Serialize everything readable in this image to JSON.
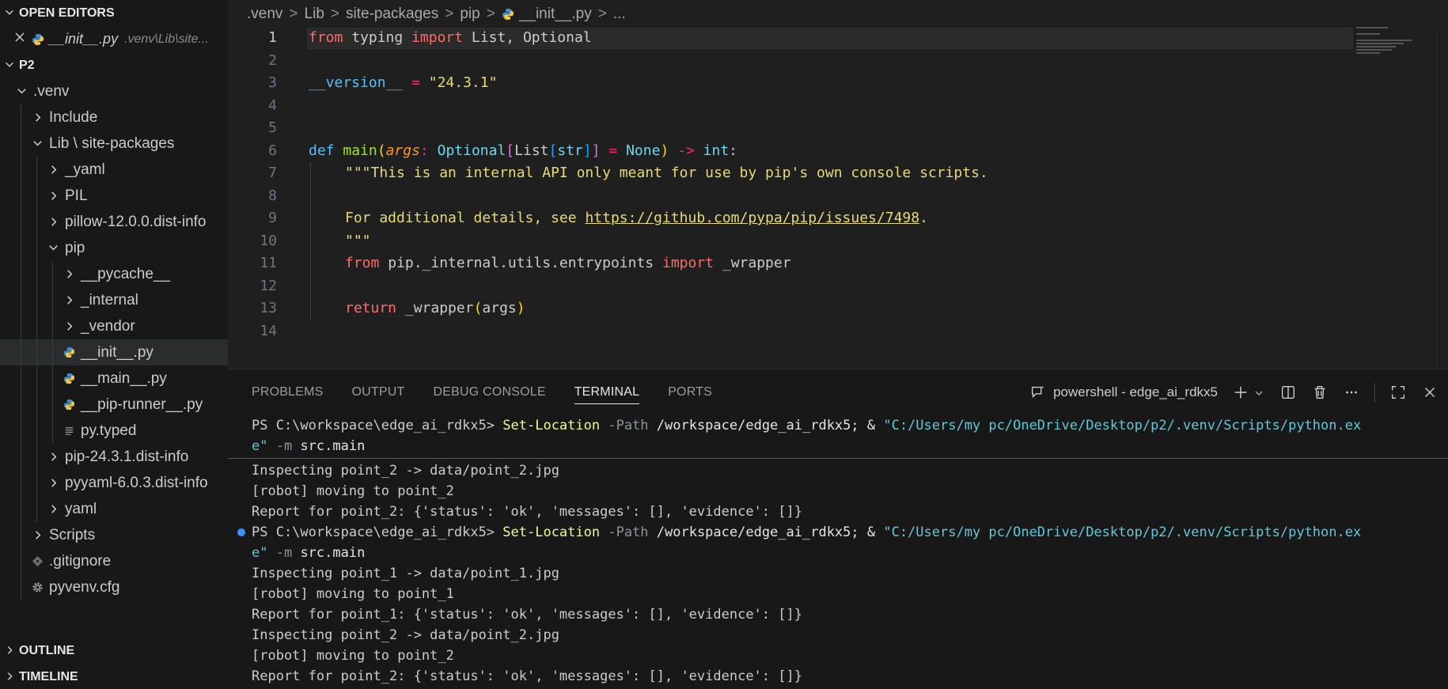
{
  "sidebar": {
    "open_editors_title": "OPEN EDITORS",
    "open_editor": {
      "name": "__init__.py",
      "path": ".venv\\Lib\\site..."
    },
    "project_title": "P2",
    "tree": [
      {
        "label": ".venv",
        "depth": 0,
        "kind": "folder-open"
      },
      {
        "label": "Include",
        "depth": 1,
        "kind": "folder"
      },
      {
        "label": "Lib \\ site-packages",
        "depth": 1,
        "kind": "folder-open"
      },
      {
        "label": "_yaml",
        "depth": 2,
        "kind": "folder"
      },
      {
        "label": "PIL",
        "depth": 2,
        "kind": "folder"
      },
      {
        "label": "pillow-12.0.0.dist-info",
        "depth": 2,
        "kind": "folder"
      },
      {
        "label": "pip",
        "depth": 2,
        "kind": "folder-open"
      },
      {
        "label": "__pycache__",
        "depth": 3,
        "kind": "folder"
      },
      {
        "label": "_internal",
        "depth": 3,
        "kind": "folder"
      },
      {
        "label": "_vendor",
        "depth": 3,
        "kind": "folder"
      },
      {
        "label": "__init__.py",
        "depth": 3,
        "kind": "py",
        "selected": true
      },
      {
        "label": "__main__.py",
        "depth": 3,
        "kind": "py"
      },
      {
        "label": "__pip-runner__.py",
        "depth": 3,
        "kind": "py"
      },
      {
        "label": "py.typed",
        "depth": 3,
        "kind": "text"
      },
      {
        "label": "pip-24.3.1.dist-info",
        "depth": 2,
        "kind": "folder"
      },
      {
        "label": "pyyaml-6.0.3.dist-info",
        "depth": 2,
        "kind": "folder"
      },
      {
        "label": "yaml",
        "depth": 2,
        "kind": "folder"
      },
      {
        "label": "Scripts",
        "depth": 1,
        "kind": "folder"
      },
      {
        "label": ".gitignore",
        "depth": 1,
        "kind": "git"
      },
      {
        "label": "pyvenv.cfg",
        "depth": 1,
        "kind": "gear"
      }
    ],
    "outline_title": "OUTLINE",
    "timeline_title": "TIMELINE"
  },
  "breadcrumb": [
    ".venv",
    "Lib",
    "site-packages",
    "pip",
    "__init__.py",
    "..."
  ],
  "editor": {
    "current_line": 1,
    "line_numbers": [
      "1",
      "2",
      "3",
      "4",
      "5",
      "6",
      "7",
      "8",
      "9",
      "10",
      "11",
      "12",
      "13",
      "14"
    ],
    "code": {
      "l1_from": "from",
      "l1_mod": " typing ",
      "l1_import": "import",
      "l1_names": " List, Optional",
      "l3_name": "__version__",
      "l3_eq": " = ",
      "l3_val": "\"24.3.1\"",
      "l6_def": "def",
      "l6_fn": "main",
      "l6_p1": "(",
      "l6_arg": "args",
      "l6_colon": ": ",
      "l6_opt": "Optional",
      "l6_b1": "[",
      "l6_list": "List",
      "l6_b2": "[",
      "l6_str": "str",
      "l6_b2c": "]",
      "l6_b1c": "]",
      "l6_eq": " = ",
      "l6_none": "None",
      "l6_p1c": ")",
      "l6_arrow": " -> ",
      "l6_int": "int",
      "l6_end": ":",
      "l7": "\"\"\"This is an internal API only meant for use by pip's own console scripts.",
      "l9_pre": "For additional details, see ",
      "l9_url": "https://github.com/pypa/pip/issues/7498",
      "l9_post": ".",
      "l10": "\"\"\"",
      "l11_from": "from",
      "l11_mod": " pip._internal.utils.entrypoints ",
      "l11_import": "import",
      "l11_name": " _wrapper",
      "l13_return": "return",
      "l13_call": " _wrapper",
      "l13_p": "(",
      "l13_arg": "args",
      "l13_pc": ")"
    }
  },
  "panel": {
    "tabs": [
      "PROBLEMS",
      "OUTPUT",
      "DEBUG CONSOLE",
      "TERMINAL",
      "PORTS"
    ],
    "active_tab": "TERMINAL",
    "terminal_name": "powershell - edge_ai_rdkx5",
    "terminal": {
      "prompt": "PS C:\\workspace\\edge_ai_rdkx5> ",
      "cmd": "Set-Location",
      "param": " -Path ",
      "path": "/workspace/edge_ai_rdkx5; & ",
      "exe_part1": "\"C:/Users/my pc/OneDrive/Desktop/p2/.venv/Scripts/python.ex",
      "exe_part2": "e\"",
      "args_flag": " -m ",
      "args_mod": "src.main",
      "out1": "Inspecting point_2 -> data/point_2.jpg",
      "out2": "[robot] moving to point_2",
      "out3": "Report for point_2: {'status': 'ok', 'messages': [], 'evidence': []}",
      "out4": "Inspecting point_1 -> data/point_1.jpg",
      "out5": "[robot] moving to point_1",
      "out6": "Report for point_1: {'status': 'ok', 'messages': [], 'evidence': []}",
      "out7": "Inspecting point_2 -> data/point_2.jpg",
      "out8": "[robot] moving to point_2",
      "out9": "Report for point_2: {'status': 'ok', 'messages': [], 'evidence': []}"
    }
  },
  "colors": {
    "accent": "#3794ff",
    "keyword": "#ff6b6b",
    "string": "#e6db74"
  }
}
